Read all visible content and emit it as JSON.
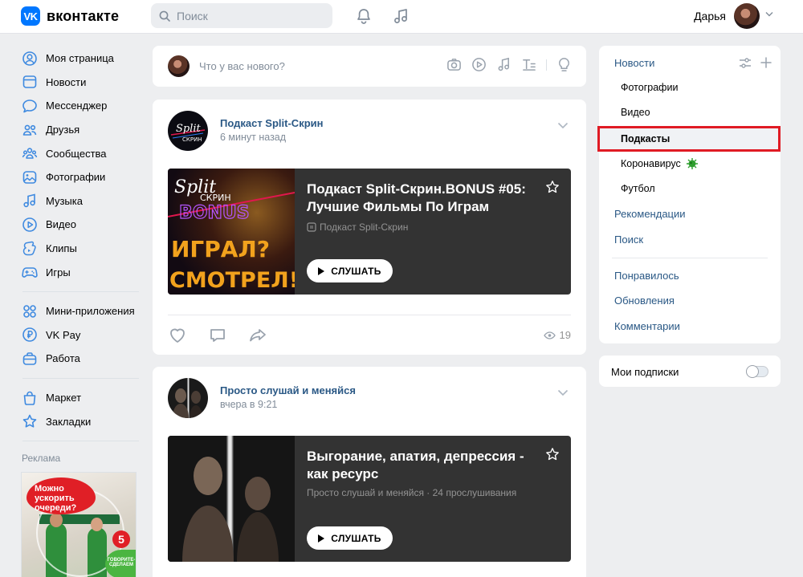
{
  "header": {
    "logo_letters": "VK",
    "logo_text": "вконтакте",
    "search_placeholder": "Поиск",
    "user_name": "Дарья"
  },
  "leftnav": {
    "group1": [
      {
        "label": "Моя страница",
        "icon": "user-circle-icon"
      },
      {
        "label": "Новости",
        "icon": "newspaper-icon"
      },
      {
        "label": "Мессенджер",
        "icon": "message-icon"
      },
      {
        "label": "Друзья",
        "icon": "friends-icon"
      },
      {
        "label": "Сообщества",
        "icon": "communities-icon"
      },
      {
        "label": "Фотографии",
        "icon": "photo-icon"
      },
      {
        "label": "Музыка",
        "icon": "music-icon"
      },
      {
        "label": "Видео",
        "icon": "video-icon"
      },
      {
        "label": "Клипы",
        "icon": "clips-icon"
      },
      {
        "label": "Игры",
        "icon": "gamepad-icon"
      }
    ],
    "group2": [
      {
        "label": "Мини-приложения",
        "icon": "apps-icon"
      },
      {
        "label": "VK Pay",
        "icon": "vkpay-icon"
      },
      {
        "label": "Работа",
        "icon": "briefcase-icon"
      }
    ],
    "group3": [
      {
        "label": "Маркет",
        "icon": "bag-icon"
      },
      {
        "label": "Закладки",
        "icon": "star-icon"
      }
    ],
    "ad_label": "Реклама",
    "ad": {
      "bubble": "Можно ускорить очереди?",
      "tag": "ГОВОРИТЕ-СДЕЛАЕМ",
      "number": "5"
    }
  },
  "composer": {
    "placeholder": "Что у вас нового?"
  },
  "posts": [
    {
      "author": "Подкаст Split-Скрин",
      "time": "6 минут назад",
      "podcast_title": "Подкаст Split-Скрин.BONUS #05: Лучшие Фильмы По Играм",
      "podcast_sub": "Подкаст Split-Скрин",
      "cover_lines": [
        "Split",
        "СКРИН",
        "BONUS",
        "ИГРАЛ?",
        "СМОТРЕЛ!"
      ],
      "listen": "СЛУШАТЬ",
      "views": "19"
    },
    {
      "author": "Просто слушай и меняйся",
      "time": "вчера в 9:21",
      "podcast_title": "Выгорание, апатия, депрессия - как ресурс",
      "podcast_sub": "Просто слушай и меняйся · 24 прослушивания",
      "listen": "СЛУШАТЬ"
    }
  ],
  "rightmenu": {
    "news": "Новости",
    "subs": [
      "Фотографии",
      "Видео",
      "Подкасты",
      "Коронавирус",
      "Футбол"
    ],
    "links1": [
      "Рекомендации",
      "Поиск"
    ],
    "links2": [
      "Понравилось",
      "Обновления",
      "Комментарии"
    ]
  },
  "subscriptions": {
    "label": "Мои подписки"
  },
  "colors": {
    "accent": "#0077ff",
    "link": "#2a5885",
    "highlight_border": "#e01b24",
    "podcast_bg": "#333333"
  }
}
